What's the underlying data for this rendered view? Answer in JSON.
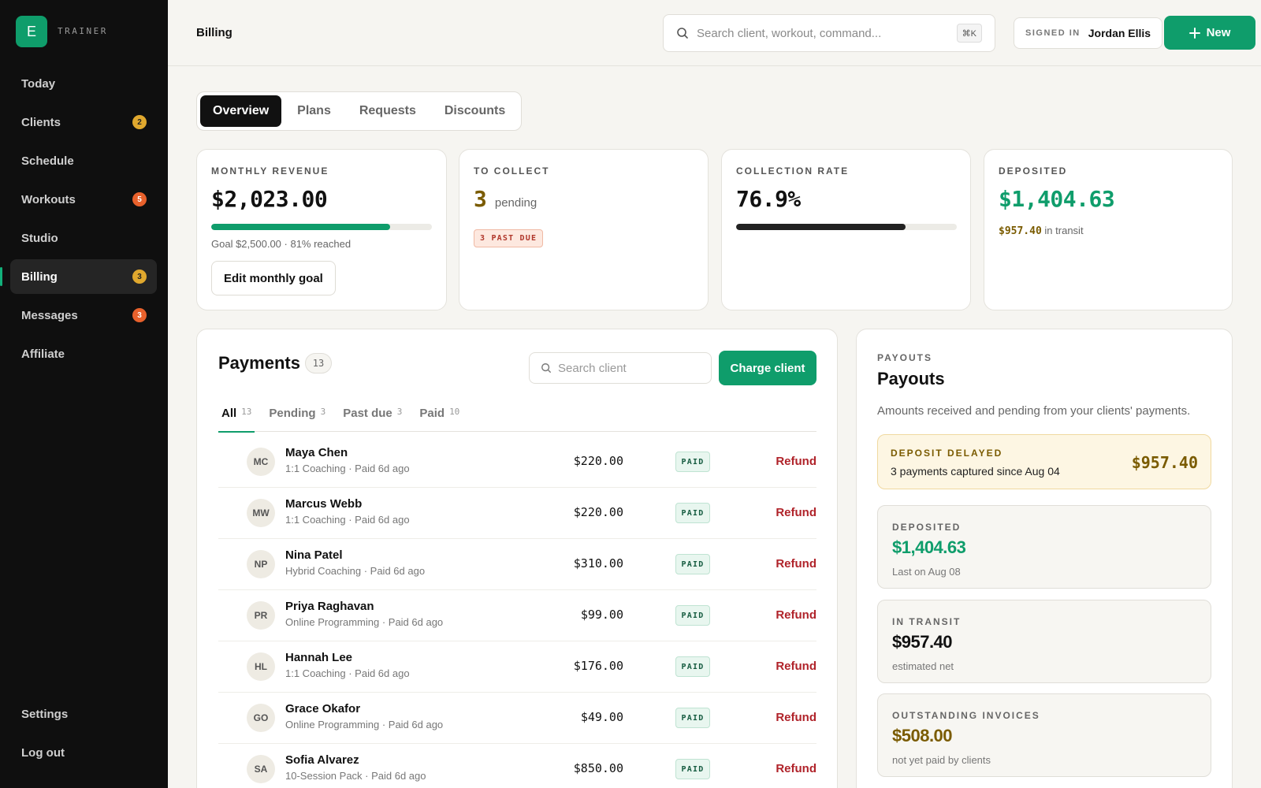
{
  "app": {
    "logo_letter": "E",
    "brand": "TRAINER"
  },
  "sidebar": {
    "items": [
      {
        "label": "Today",
        "badge": ""
      },
      {
        "label": "Clients",
        "badge": "2"
      },
      {
        "label": "Schedule",
        "badge": ""
      },
      {
        "label": "Workouts",
        "badge": "5"
      },
      {
        "label": "Studio",
        "badge": ""
      },
      {
        "label": "Billing",
        "badge": "3"
      },
      {
        "label": "Messages",
        "badge": "3"
      },
      {
        "label": "Affiliate",
        "badge": ""
      }
    ],
    "active": "Billing",
    "bottom": [
      {
        "label": "Settings"
      },
      {
        "label": "Log out"
      }
    ]
  },
  "header": {
    "title": "Billing",
    "search_placeholder": "Search client, workout, command...",
    "search_shortcut": "⌘K",
    "signed_in_label": "SIGNED IN",
    "user_name": "Jordan Ellis",
    "new_label": "New"
  },
  "tabs": [
    {
      "label": "Overview"
    },
    {
      "label": "Plans"
    },
    {
      "label": "Requests"
    },
    {
      "label": "Discounts"
    }
  ],
  "stats": {
    "revenue": {
      "label": "MONTHLY REVENUE",
      "value": "$2,023.00",
      "progress": 0.81,
      "goal_text": "Goal $2,500.00 · 81% reached",
      "edit_label": "Edit monthly goal"
    },
    "collect": {
      "label": "TO COLLECT",
      "value": "3",
      "unit": "pending",
      "tag": "3 PAST DUE"
    },
    "rate": {
      "label": "COLLECTION RATE",
      "value": "76.9%",
      "progress": 0.769
    },
    "deposited": {
      "label": "DEPOSITED",
      "value": "$1,404.63",
      "transit_amount": "$957.40",
      "transit_text": "in transit"
    }
  },
  "payments": {
    "title": "Payments",
    "count": "13",
    "search_placeholder": "Search client",
    "charge_label": "Charge client",
    "filters": [
      {
        "label": "All",
        "count": "13"
      },
      {
        "label": "Pending",
        "count": "3"
      },
      {
        "label": "Past due",
        "count": "3"
      },
      {
        "label": "Paid",
        "count": "10"
      }
    ],
    "rows": [
      {
        "initials": "MC",
        "name": "Maya Chen",
        "sub": "1:1 Coaching · Paid 6d ago",
        "amount": "$220.00",
        "status": "PAID",
        "action": "Refund"
      },
      {
        "initials": "MW",
        "name": "Marcus Webb",
        "sub": "1:1 Coaching · Paid 6d ago",
        "amount": "$220.00",
        "status": "PAID",
        "action": "Refund"
      },
      {
        "initials": "NP",
        "name": "Nina Patel",
        "sub": "Hybrid Coaching · Paid 6d ago",
        "amount": "$310.00",
        "status": "PAID",
        "action": "Refund"
      },
      {
        "initials": "PR",
        "name": "Priya Raghavan",
        "sub": "Online Programming · Paid 6d ago",
        "amount": "$99.00",
        "status": "PAID",
        "action": "Refund"
      },
      {
        "initials": "HL",
        "name": "Hannah Lee",
        "sub": "1:1 Coaching · Paid 6d ago",
        "amount": "$176.00",
        "status": "PAID",
        "action": "Refund"
      },
      {
        "initials": "GO",
        "name": "Grace Okafor",
        "sub": "Online Programming · Paid 6d ago",
        "amount": "$49.00",
        "status": "PAID",
        "action": "Refund"
      },
      {
        "initials": "SA",
        "name": "Sofia Alvarez",
        "sub": "10-Session Pack · Paid 6d ago",
        "amount": "$850.00",
        "status": "PAID",
        "action": "Refund"
      }
    ]
  },
  "payouts": {
    "kicker": "PAYOUTS",
    "title": "Payouts",
    "description": "Amounts received and pending from your clients' payments.",
    "delayed": {
      "label": "DEPOSIT DELAYED",
      "text": "3 payments captured since Aug 04",
      "amount": "$957.40"
    },
    "deposited": {
      "label": "DEPOSITED",
      "value": "$1,404.63",
      "sub": "Last on Aug 08"
    },
    "transit": {
      "label": "IN TRANSIT",
      "value": "$957.40",
      "sub": "estimated net"
    },
    "outstanding": {
      "label": "OUTSTANDING INVOICES",
      "value": "$508.00",
      "sub": "not yet paid by clients"
    }
  },
  "colors": {
    "accent": "#0f9d6b",
    "amber": "#7a5b00",
    "danger": "#b0232a"
  }
}
